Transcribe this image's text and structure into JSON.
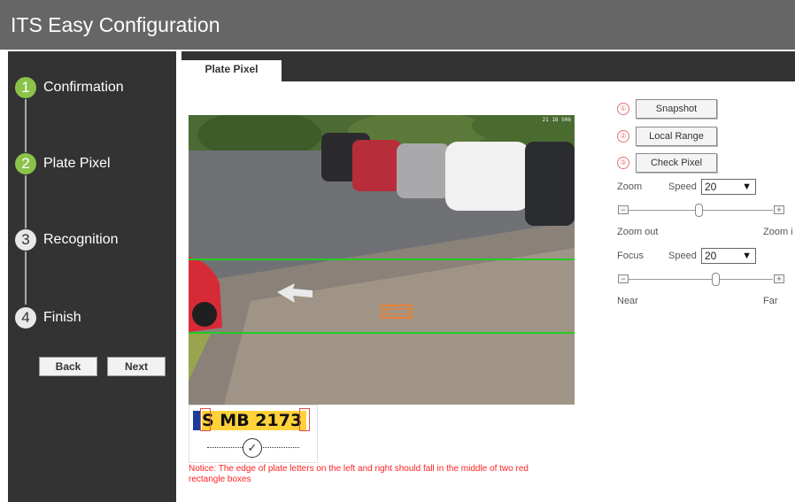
{
  "app": {
    "title": "ITS Easy Configuration"
  },
  "steps": [
    {
      "num": "1",
      "label": "Confirmation",
      "active": true
    },
    {
      "num": "2",
      "label": "Plate Pixel",
      "active": true
    },
    {
      "num": "3",
      "label": "Recognition",
      "active": false
    },
    {
      "num": "4",
      "label": "Finish",
      "active": false
    }
  ],
  "nav": {
    "back": "Back",
    "next": "Next"
  },
  "tabs": [
    {
      "label": "Plate Pixel",
      "active": true
    }
  ],
  "controls": {
    "snapshot": {
      "index": "①",
      "label": "Snapshot"
    },
    "local_range": {
      "index": "②",
      "label": "Local Range"
    },
    "check_pixel": {
      "index": "③",
      "label": "Check Pixel"
    },
    "zoom": {
      "label": "Zoom",
      "speed_label": "Speed",
      "speed": "20",
      "min_label": "Zoom out",
      "max_label": "Zoom i",
      "level": 0.5
    },
    "focus": {
      "label": "Focus",
      "speed_label": "Speed",
      "speed": "20",
      "min_label": "Near",
      "max_label": "Far",
      "level": 0.63
    }
  },
  "preview": {
    "timestamp": "21 18 506"
  },
  "sample_plate": {
    "text": "S MB 2173"
  },
  "notice": "Notice:  The edge of plate letters on the left and right should fall in the middle of two red rectangle boxes",
  "colors": {
    "accent_green": "#8bc34a",
    "notice_red": "#ff2222",
    "guide_line": "#22cc22",
    "detect_box": "#ff7a1a"
  }
}
